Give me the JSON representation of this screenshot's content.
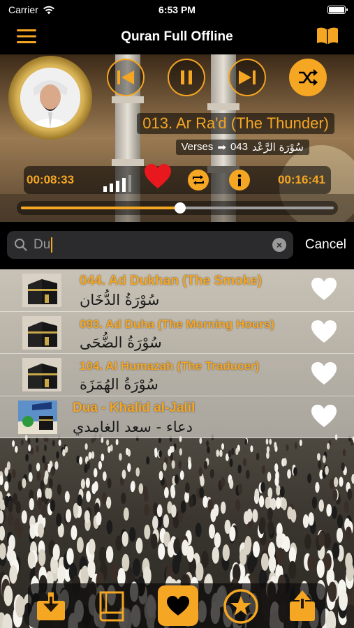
{
  "status": {
    "carrier": "Carrier",
    "time": "6:53 PM"
  },
  "nav": {
    "title": "Quran Full Offline"
  },
  "player": {
    "track_title": "013. Ar Ra'd (The Thunder)",
    "verses_label": "Verses",
    "verses_arrow": "➡",
    "verses_count": "043",
    "arabic_name": "سُوْرَة الرَّعْد",
    "elapsed": "00:08:33",
    "total": "00:16:41",
    "progress": 0.51,
    "favorited": true
  },
  "search": {
    "query": "Du",
    "cancel_label": "Cancel"
  },
  "results": [
    {
      "title": "044. Ad Dukhan (The Smoke)",
      "arabic": "سُوْرَةُ الدُّخَان",
      "thumb": "kaaba-icon"
    },
    {
      "title": "093. Ad Duha (The Morning Hours)",
      "arabic": "سُوْرَةُ الضُّحَى",
      "thumb": "kaaba-icon"
    },
    {
      "title": "104. Al Humazah (The Traducer)",
      "arabic": "سُوْرَةُ الهُمَزَة",
      "thumb": "kaaba-icon"
    },
    {
      "title": "Dua - Khalid al-Jalil",
      "arabic": "دعاء - سعد الغامدي",
      "thumb": "mosque-icon"
    }
  ],
  "tabs": [
    {
      "icon": "download-icon",
      "active": false
    },
    {
      "icon": "book-icon",
      "active": false
    },
    {
      "icon": "favorites-heart-icon",
      "active": true
    },
    {
      "icon": "star-icon",
      "active": false
    },
    {
      "icon": "share-icon",
      "active": false
    }
  ],
  "colors": {
    "accent": "#f5a623",
    "heart_red": "#e8181e",
    "nav_bg": "#000000"
  }
}
